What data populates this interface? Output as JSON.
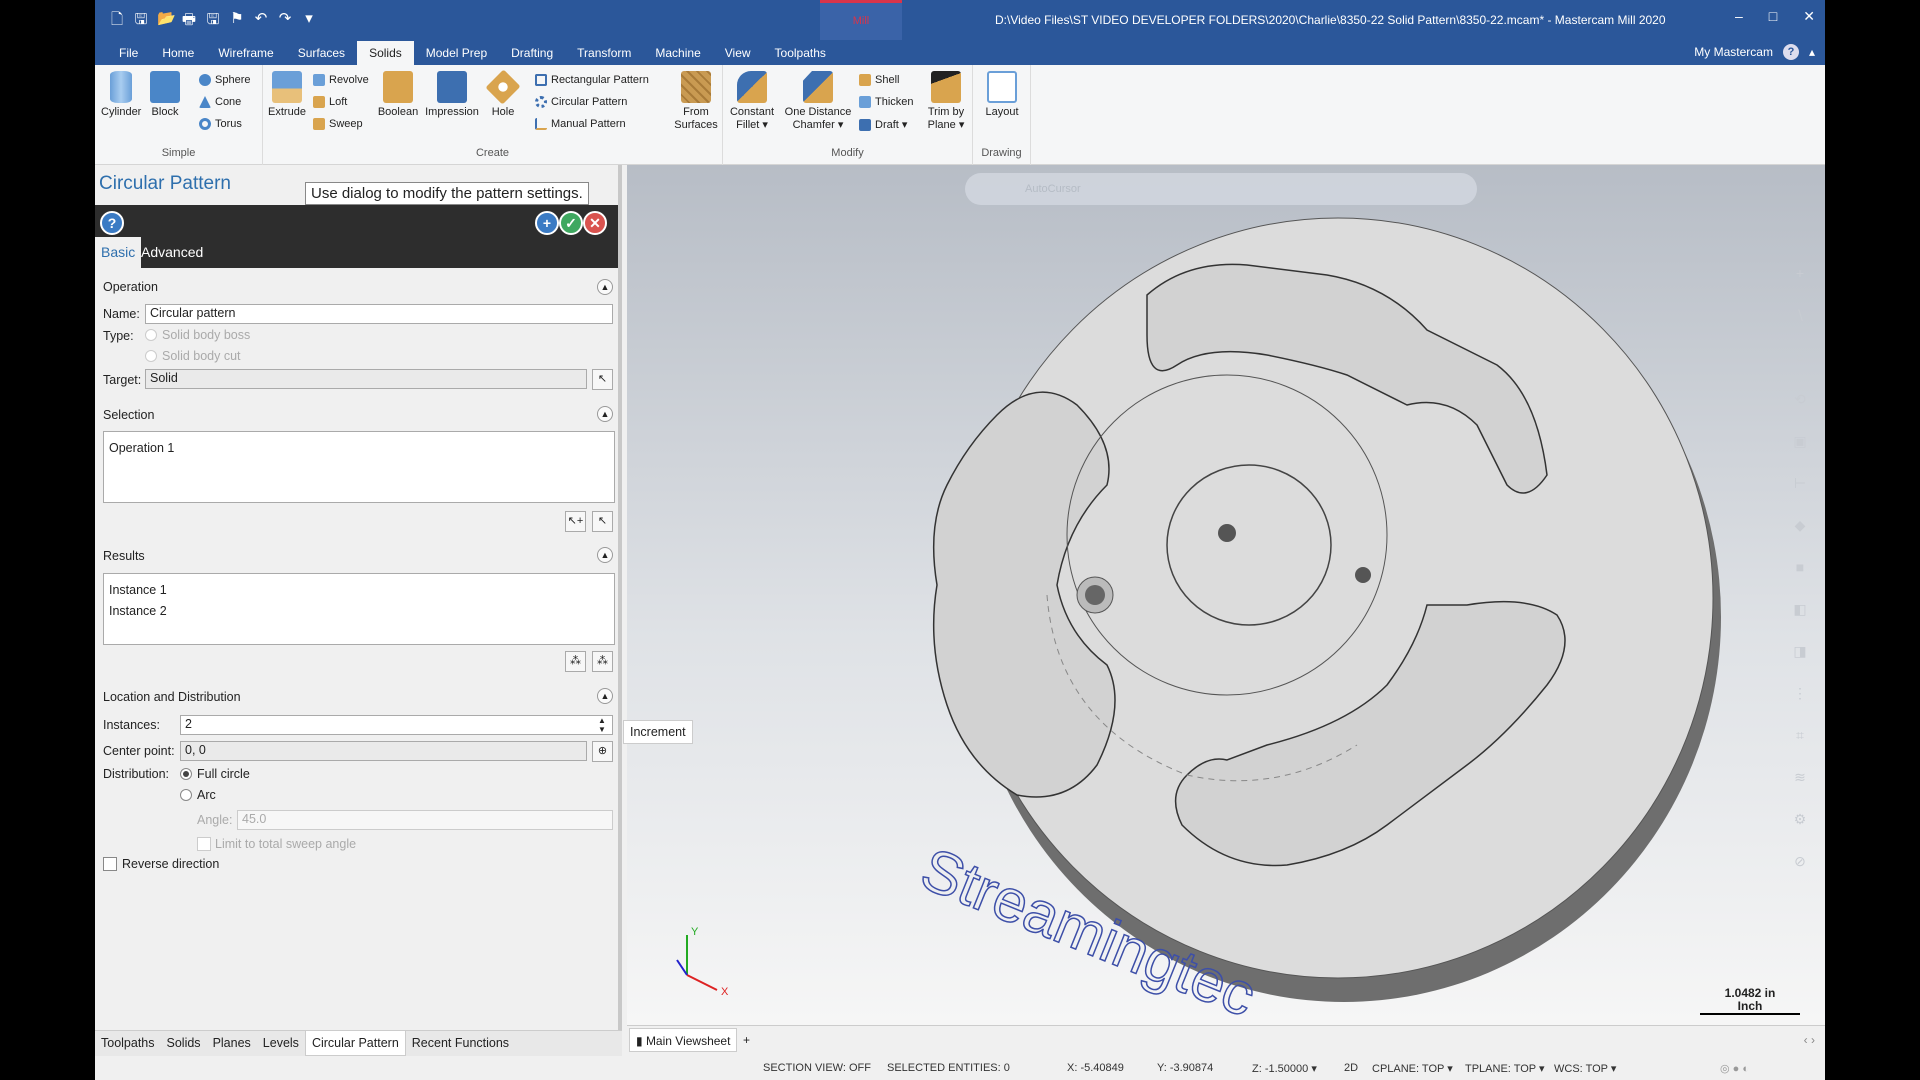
{
  "titlebar": {
    "title": "D:\\Video Files\\ST VIDEO DEVELOPER FOLDERS\\2020\\Charlie\\8350-22 Solid Pattern\\8350-22.mcam* - Mastercam Mill 2020",
    "context_tab": "Mill",
    "minimize": "–",
    "maximize": "□",
    "close": "✕"
  },
  "ribbon_tabs": [
    "File",
    "Home",
    "Wireframe",
    "Surfaces",
    "Solids",
    "Model Prep",
    "Drafting",
    "Transform",
    "Machine",
    "View",
    "Toolpaths"
  ],
  "active_tab": "Solids",
  "my_mastercam": "My Mastercam",
  "ribbon": {
    "simple": {
      "label": "Simple",
      "cylinder": "Cylinder",
      "block": "Block",
      "sphere": "Sphere",
      "cone": "Cone",
      "torus": "Torus"
    },
    "create": {
      "label": "Create",
      "extrude": "Extrude",
      "revolve": "Revolve",
      "loft": "Loft",
      "sweep": "Sweep",
      "boolean": "Boolean",
      "impression": "Impression",
      "hole": "Hole",
      "rect_pattern": "Rectangular Pattern",
      "circ_pattern": "Circular Pattern",
      "manual_pattern": "Manual Pattern",
      "from_surfaces_1": "From",
      "from_surfaces_2": "Surfaces"
    },
    "modify": {
      "label": "Modify",
      "fillet_1": "Constant",
      "fillet_2": "Fillet ▾",
      "chamfer_1": "One Distance",
      "chamfer_2": "Chamfer ▾",
      "shell": "Shell",
      "thicken": "Thicken",
      "draft": "Draft ▾",
      "trim_1": "Trim by",
      "trim_2": "Plane ▾"
    },
    "drawing": {
      "label": "Drawing",
      "layout": "Layout"
    }
  },
  "panel": {
    "title": "Circular Pattern",
    "tooltip": "Use dialog to modify the pattern settings.",
    "tabs": {
      "basic": "Basic",
      "advanced": "Advanced"
    },
    "operation": {
      "header": "Operation",
      "name_label": "Name:",
      "name_value": "Circular pattern",
      "type_label": "Type:",
      "type_boss": "Solid body boss",
      "type_cut": "Solid body cut",
      "target_label": "Target:",
      "target_value": "Solid"
    },
    "selection": {
      "header": "Selection",
      "items": [
        "Operation 1"
      ]
    },
    "results": {
      "header": "Results",
      "items": [
        "Instance 1",
        "Instance 2"
      ]
    },
    "location": {
      "header": "Location and Distribution",
      "instances_label": "Instances:",
      "instances_value": "2",
      "center_label": "Center point:",
      "center_value": "0, 0",
      "distribution_label": "Distribution:",
      "full_circle": "Full circle",
      "arc": "Arc",
      "angle_label": "Angle:",
      "angle_value": "45.0",
      "limit_sweep": "Limit to total sweep angle",
      "reverse": "Reverse direction"
    },
    "increment_tooltip": "Increment"
  },
  "panel_tabs": [
    "Toolpaths",
    "Solids",
    "Planes",
    "Levels",
    "Circular Pattern",
    "Recent Functions"
  ],
  "active_panel_tab": "Circular Pattern",
  "viewport": {
    "toolbar_autocursor": "AutoCursor",
    "scale_value": "1.0482 in",
    "scale_unit": "Inch",
    "axis_x": "X",
    "axis_y": "Y",
    "watermark": "Streamingtec"
  },
  "viewsheet": {
    "tab": "Main Viewsheet",
    "add": "+"
  },
  "status": {
    "section_view": "SECTION VIEW: OFF",
    "selected": "SELECTED ENTITIES: 0",
    "x": "X:  -5.40849",
    "y": "Y:  -3.90874",
    "z": "Z:  -1.50000 ▾",
    "mode": "2D",
    "cplane": "CPLANE: TOP ▾",
    "tplane": "TPLANE: TOP ▾",
    "wcs": "WCS: TOP ▾"
  },
  "colors": {
    "accent": "#2b579a",
    "panel_title": "#2e6fad",
    "ok": "#3fa860",
    "cancel": "#d9534f"
  }
}
